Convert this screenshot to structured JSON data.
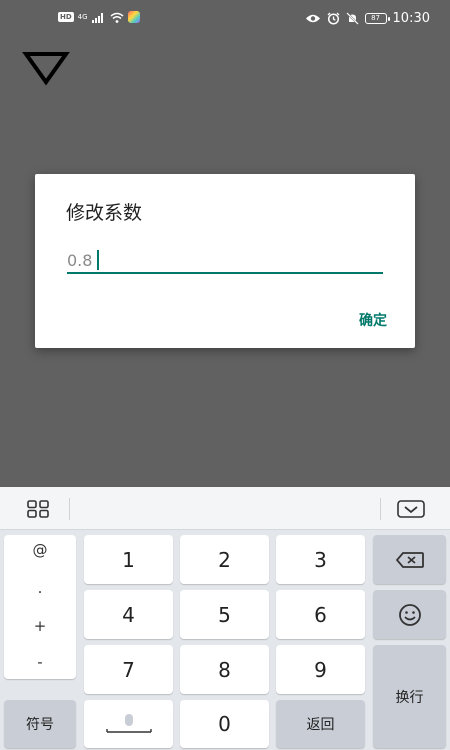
{
  "status_bar": {
    "left_badges": [
      "HD",
      "4G"
    ],
    "battery": "87",
    "time": "10:30"
  },
  "dialog": {
    "title": "修改系数",
    "input_value": "0.8",
    "confirm_label": "确定"
  },
  "keyboard": {
    "symbols": [
      "@",
      ".",
      "+",
      "-"
    ],
    "digits": [
      "1",
      "2",
      "3",
      "4",
      "5",
      "6",
      "7",
      "8",
      "9",
      "0"
    ],
    "symbol_key": "符号",
    "back_key": "返回",
    "enter_key": "换行"
  },
  "colors": {
    "accent": "#00796b",
    "dim_background": "#616161"
  },
  "icons": [
    "triangle-down-icon",
    "grid-icon",
    "keyboard-hide-icon",
    "backspace-icon",
    "emoji-icon",
    "mic-icon"
  ]
}
